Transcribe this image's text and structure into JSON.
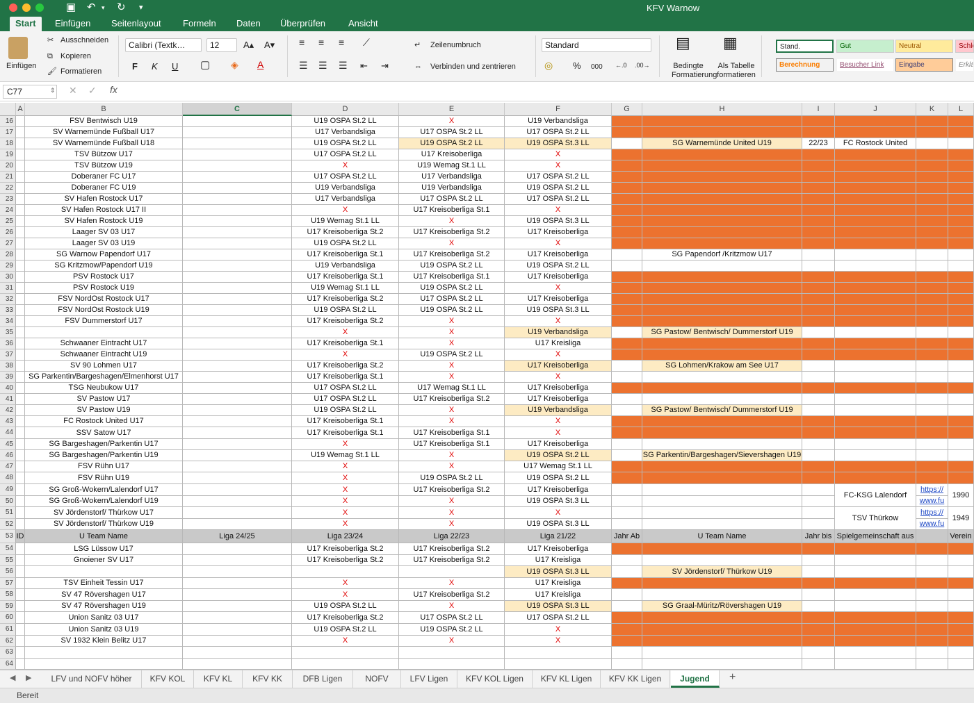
{
  "app": {
    "title": "KFV Warnow",
    "ribbon_tabs": [
      "Start",
      "Einfügen",
      "Seitenlayout",
      "Formeln",
      "Daten",
      "Überprüfen",
      "Ansicht"
    ],
    "active_tab": "Start"
  },
  "ribbon": {
    "paste": "Einfügen",
    "cut": "Ausschneiden",
    "copy": "Kopieren",
    "format_painter": "Formatieren",
    "font_name": "Calibri (Textk…",
    "font_size": "12",
    "bold": "F",
    "italic": "K",
    "underline": "U",
    "wrap_text": "Zeilenumbruch",
    "merge_center": "Verbinden und zentrieren",
    "number_format": "Standard",
    "percent": "%",
    "thousands": "000",
    "cond_format": "Bedingte Formatierung",
    "as_table": "Als Tabelle formatieren",
    "styles": {
      "stand": "Stand.",
      "gut": "Gut",
      "neutral": "Neutral",
      "schlecht": "Schle",
      "berechnung": "Berechnung",
      "besucher_link": "Besucher Link",
      "eingabe": "Eingabe",
      "erklaerend": "Erklä"
    }
  },
  "formula": {
    "name_box": "C77",
    "fx": "fx",
    "content": ""
  },
  "columns": [
    "A",
    "B",
    "C",
    "D",
    "E",
    "F",
    "G",
    "H",
    "I",
    "J",
    "K",
    "L"
  ],
  "rows": [
    {
      "n": "16",
      "b": "FSV Bentwisch U19",
      "d": "U19 OSPA St.2 LL",
      "e": "X",
      "f": "U19 Verbandsliga",
      "o": 1
    },
    {
      "n": "17",
      "b": "SV Warnemünde Fußball U17",
      "d": "U17 Verbandsliga",
      "e": "U17 OSPA St.2 LL",
      "f": "U17 OSPA St.2 LL",
      "o": 1
    },
    {
      "n": "18",
      "b": "SV Warnemünde Fußball U18",
      "d": "U19 OSPA St.2 LL",
      "e": "U19 OSPA St.2 LL",
      "f": "U19 OSPA St.3 LL",
      "h": "SG Warnemünde United U19",
      "i": "22/23",
      "j": "FC Rostock United",
      "ye": [
        "e",
        "f",
        "h"
      ]
    },
    {
      "n": "19",
      "b": "TSV Bützow U17",
      "d": "U17 OSPA St.2 LL",
      "e": "U17 Kreisoberliga",
      "f": "X",
      "o": 1
    },
    {
      "n": "20",
      "b": "TSV Bützow U19",
      "d": "X",
      "e": "U19 Wemag St.1 LL",
      "f": "X",
      "o": 1
    },
    {
      "n": "21",
      "b": "Doberaner FC U17",
      "d": "U17 OSPA St.2 LL",
      "e": "U17 Verbandsliga",
      "f": "U17 OSPA St.2 LL",
      "o": 1
    },
    {
      "n": "22",
      "b": "Doberaner FC U19",
      "d": "U19 Verbandsliga",
      "e": "U19 Verbandsliga",
      "f": "U19 OSPA St.2 LL",
      "o": 1
    },
    {
      "n": "23",
      "b": "SV Hafen Rostock U17",
      "d": "U17 Verbandsliga",
      "e": "U17 OSPA St.2 LL",
      "f": "U17 OSPA St.2 LL",
      "o": 1
    },
    {
      "n": "24",
      "b": "SV Hafen Rostock U17 II",
      "d": "X",
      "e": "U17 Kreisoberliga St.1",
      "f": "X",
      "o": 1
    },
    {
      "n": "25",
      "b": "SV Hafen Rostock U19",
      "d": "U19 Wemag St.1 LL",
      "e": "X",
      "f": "U19 OSPA St.3 LL",
      "o": 1
    },
    {
      "n": "26",
      "b": "Laager SV 03 U17",
      "d": "U17 Kreisoberliga St.2",
      "e": "U17 Kreisoberliga St.2",
      "f": "U17 Kreisoberliga",
      "o": 1
    },
    {
      "n": "27",
      "b": "Laager SV 03 U19",
      "d": "U19 OSPA St.2 LL",
      "e": "X",
      "f": "X",
      "o": 1
    },
    {
      "n": "28",
      "b": "SG Warnow Papendorf U17",
      "d": "U17 Kreisoberliga St.1",
      "e": "U17 Kreisoberliga St.2",
      "f": "U17 Kreisoberliga",
      "h": "SG Papendorf /Kritzmow U17"
    },
    {
      "n": "29",
      "b": "SG Kritzmow/Papendorf U19",
      "d": "U19 Verbandsliga",
      "e": "U19 OSPA St.2 LL",
      "f": "U19 OSPA St.2 LL"
    },
    {
      "n": "30",
      "b": "PSV Rostock U17",
      "d": "U17 Kreisoberliga St.1",
      "e": "U17 Kreisoberliga St.1",
      "f": "U17 Kreisoberliga",
      "o": 1
    },
    {
      "n": "31",
      "b": "PSV Rostock U19",
      "d": "U19 Wemag St.1 LL",
      "e": "U19 OSPA St.2 LL",
      "f": "X",
      "o": 1
    },
    {
      "n": "32",
      "b": "FSV NordOst Rostock U17",
      "d": "U17 Kreisoberliga St.2",
      "e": "U17 OSPA St.2 LL",
      "f": "U17 Kreisoberliga",
      "o": 1
    },
    {
      "n": "33",
      "b": "FSV NordOst Rostock U19",
      "d": "U19 OSPA St.2 LL",
      "e": "U19 OSPA St.2 LL",
      "f": "U19 OSPA St.3 LL",
      "o": 1
    },
    {
      "n": "34",
      "b": "FSV Dummerstorf U17",
      "d": "U17 Kreisoberliga St.2",
      "e": "X",
      "f": "X",
      "o": 1
    },
    {
      "n": "35",
      "b": "",
      "d": "X",
      "e": "X",
      "f": "U19 Verbandsliga",
      "h": "SG Pastow/ Bentwisch/ Dummerstorf U19",
      "ye": [
        "f",
        "h"
      ]
    },
    {
      "n": "36",
      "b": "Schwaaner Eintracht U17",
      "d": "U17 Kreisoberliga St.1",
      "e": "X",
      "f": "U17 Kreisliga",
      "o": 1
    },
    {
      "n": "37",
      "b": "Schwaaner Eintracht U19",
      "d": "X",
      "e": "U19 OSPA St.2 LL",
      "f": "X",
      "o": 1
    },
    {
      "n": "38",
      "b": "SV 90 Lohmen U17",
      "d": "U17 Kreisoberliga St.2",
      "e": "X",
      "f": "U17 Kreisoberliga",
      "h": "SG Lohmen/Krakow am See U17",
      "ye": [
        "f",
        "h"
      ]
    },
    {
      "n": "39",
      "b": "SG Parkentin/Bargeshagen/Elmenhorst U17",
      "d": "U17 Kreisoberliga St.1",
      "e": "X",
      "f": "X"
    },
    {
      "n": "40",
      "b": "TSG Neubukow U17",
      "d": "U17 OSPA St.2 LL",
      "e": "U17 Wemag St.1 LL",
      "f": "U17 Kreisoberliga",
      "o": 1
    },
    {
      "n": "41",
      "b": "SV Pastow U17",
      "d": "U17 OSPA St.2 LL",
      "e": "U17 Kreisoberliga St.2",
      "f": "U17 Kreisoberliga"
    },
    {
      "n": "42",
      "b": "SV Pastow U19",
      "d": "U19 OSPA St.2 LL",
      "e": "X",
      "f": "U19 Verbandsliga",
      "h": "SG Pastow/ Bentwisch/ Dummerstorf U19",
      "ye": [
        "f",
        "h"
      ]
    },
    {
      "n": "43",
      "b": "FC Rostock United U17",
      "d": "U17 Kreisoberliga St.1",
      "e": "X",
      "f": "X",
      "o": 1
    },
    {
      "n": "44",
      "b": "SSV Satow U17",
      "d": "U17 Kreisoberliga St.1",
      "e": "U17 Kreisoberliga St.1",
      "f": "X",
      "o": 1
    },
    {
      "n": "45",
      "b": "SG Bargeshagen/Parkentin U17",
      "d": "X",
      "e": "U17 Kreisoberliga St.1",
      "f": "U17 Kreisoberliga"
    },
    {
      "n": "46",
      "b": "SG Bargeshagen/Parkentin U19",
      "d": "U19 Wemag St.1 LL",
      "e": "X",
      "f": "U19 OSPA St.2 LL",
      "h": "SG Parkentin/Bargeshagen/Sievershagen U19",
      "ye": [
        "f",
        "h"
      ]
    },
    {
      "n": "47",
      "b": "FSV Rühn U17",
      "d": "X",
      "e": "X",
      "f": "U17 Wemag St.1 LL",
      "o": 1
    },
    {
      "n": "48",
      "b": "FSV Rühn U19",
      "d": "X",
      "e": "U19 OSPA St.2 LL",
      "f": "U19 OSPA St.2 LL",
      "o": 1
    },
    {
      "n": "49",
      "b": "SG Groß-Wokern/Lalendorf U17",
      "d": "X",
      "e": "U17 Kreisoberliga St.2",
      "f": "U17 Kreisoberliga",
      "k": "https://",
      "l": "1990"
    },
    {
      "n": "50",
      "b": "SG Groß-Wokern/Lalendorf U19",
      "d": "X",
      "e": "X",
      "f": "U19 OSPA St.3 LL",
      "k": "www.fu"
    },
    {
      "n": "51",
      "b": "SV Jördenstorf/ Thürkow U17",
      "d": "X",
      "e": "X",
      "f": "X",
      "k": "https://",
      "l": "1949"
    },
    {
      "n": "52",
      "b": "SV Jördenstorf/ Thürkow U19",
      "d": "X",
      "e": "X",
      "f": "U19 OSPA St.3 LL",
      "k": "www.fu"
    },
    {
      "n": "53",
      "hdr": 1,
      "a": "ID",
      "b": "U Team Name",
      "c": "Liga 24/25",
      "d": "Liga 23/24",
      "e": "Liga 22/23",
      "f": "Liga 21/22",
      "g": "Jahr Ab",
      "h": "U Team Name",
      "i": "Jahr bis",
      "j": "Spielgemeinschaft aus",
      "l": "Verein"
    },
    {
      "n": "54",
      "b": "LSG Lüssow U17",
      "d": "U17 Kreisoberliga St.2",
      "e": "U17 Kreisoberliga St.2",
      "f": "U17 Kreisoberliga",
      "o": 1
    },
    {
      "n": "55",
      "b": "Gnoiener SV U17",
      "d": "U17 Kreisoberliga St.2",
      "e": "U17 Kreisoberliga St.2",
      "f": "U17 Kreisliga"
    },
    {
      "n": "56",
      "b": "",
      "d": "",
      "e": "",
      "f": "U19 OSPA St.3 LL",
      "h": "SV Jördenstorf/ Thürkow U19",
      "ye": [
        "f",
        "h"
      ]
    },
    {
      "n": "57",
      "b": "TSV Einheit Tessin U17",
      "d": "X",
      "e": "X",
      "f": "U17 Kreisliga",
      "o": 1
    },
    {
      "n": "58",
      "b": "SV 47 Rövershagen U17",
      "d": "X",
      "e": "U17 Kreisoberliga St.2",
      "f": "U17 Kreisliga"
    },
    {
      "n": "59",
      "b": "SV 47 Rövershagen U19",
      "d": "U19 OSPA St.2 LL",
      "e": "X",
      "f": "U19 OSPA St.3 LL",
      "h": "SG Graal-Müritz/Rövershagen U19",
      "ye": [
        "f",
        "h"
      ]
    },
    {
      "n": "60",
      "b": "Union Sanitz 03 U17",
      "d": "U17 Kreisoberliga St.2",
      "e": "U17 OSPA St.2 LL",
      "f": "U17 OSPA St.2 LL",
      "o": 1
    },
    {
      "n": "61",
      "b": "Union Sanitz 03 U19",
      "d": "U19 OSPA St.2 LL",
      "e": "U19 OSPA St.2 LL",
      "f": "X",
      "o": 1
    },
    {
      "n": "62",
      "b": "SV 1932 Klein Belitz U17",
      "d": "X",
      "e": "X",
      "f": "X",
      "o": 1
    },
    {
      "n": "63",
      "b": ""
    },
    {
      "n": "64",
      "b": ""
    }
  ],
  "merged": [
    {
      "row": "49",
      "text": "FC-KSG Lalendorf"
    },
    {
      "row": "51",
      "text": "TSV Thürkow"
    }
  ],
  "sheets": [
    "LFV und NOFV  höher",
    "KFV KOL",
    "KFV KL",
    "KFV KK",
    "DFB Ligen",
    "NOFV",
    "LFV Ligen",
    "KFV KOL Ligen",
    "KFV KL Ligen",
    "KFV KK Ligen",
    "Jugend"
  ],
  "active_sheet": "Jugend",
  "status": "Bereit",
  "colors": {
    "accent": "#217346",
    "orange": "#ec722f",
    "yellow": "#fdebc3",
    "red_x": "#e00000"
  }
}
